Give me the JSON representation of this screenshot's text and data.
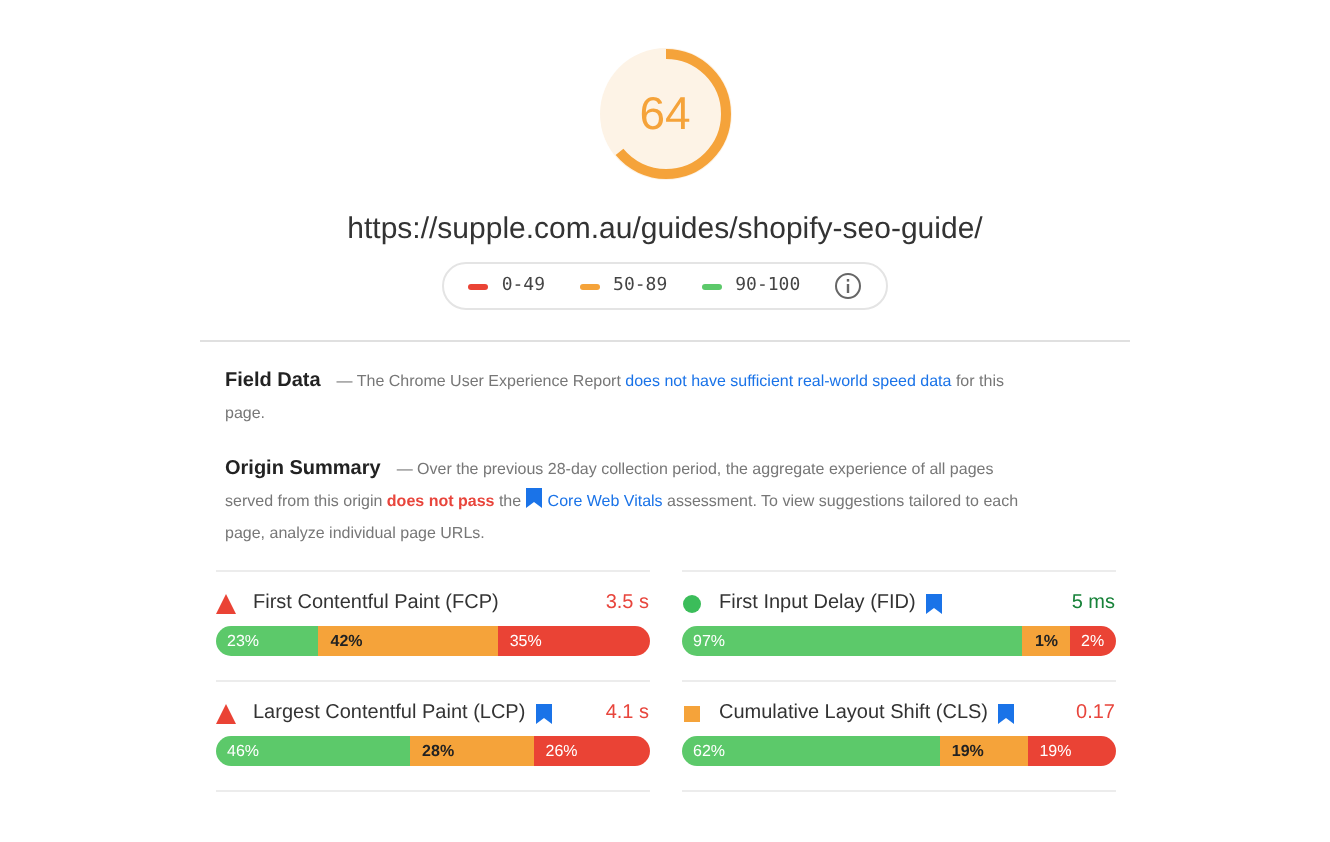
{
  "score": {
    "value": "64"
  },
  "url": "https://supple.com.au/guides/shopify-seo-guide/",
  "legend": [
    {
      "label": "0-49",
      "color": "#ea4335"
    },
    {
      "label": "50-89",
      "color": "#f5a33a"
    },
    {
      "label": "90-100",
      "color": "#5cc96a"
    }
  ],
  "field_data": {
    "title": "Field Data",
    "parts": [
      {
        "kind": "text",
        "text": "— The Chrome User Experience Report "
      },
      {
        "kind": "link",
        "text": "does not have sufficient real-world speed data"
      },
      {
        "kind": "text",
        "text": " for this page."
      }
    ]
  },
  "origin_summary": {
    "title": "Origin Summary",
    "parts": [
      {
        "kind": "text",
        "text": "— Over the previous 28-day collection period, the aggregate experience of all pages served from this origin "
      },
      {
        "kind": "alert",
        "text": "does not pass"
      },
      {
        "kind": "text",
        "text": " the "
      },
      {
        "kind": "link",
        "text": "Core Web Vitals",
        "flag": true
      },
      {
        "kind": "text",
        "text": " assessment. To view suggestions tailored to each page, analyze individual page URLs."
      }
    ]
  },
  "metrics": [
    {
      "kind": "fail",
      "name": "First Contentful Paint (FCP)",
      "flag": false,
      "value": "3.5 s",
      "segments": [
        "23%",
        "42%",
        "35%"
      ]
    },
    {
      "kind": "pass",
      "name": "First Input Delay (FID)",
      "flag": true,
      "value": "5 ms",
      "segments": [
        "97%",
        "1%",
        "2%"
      ]
    },
    {
      "kind": "fail",
      "name": "Largest Contentful Paint (LCP)",
      "flag": true,
      "value": "4.1 s",
      "segments": [
        "46%",
        "28%",
        "26%"
      ]
    },
    {
      "kind": "average",
      "name": "Cumulative Layout Shift (CLS)",
      "flag": true,
      "value": "0.17",
      "segments": [
        "62%",
        "19%",
        "19%"
      ]
    }
  ]
}
